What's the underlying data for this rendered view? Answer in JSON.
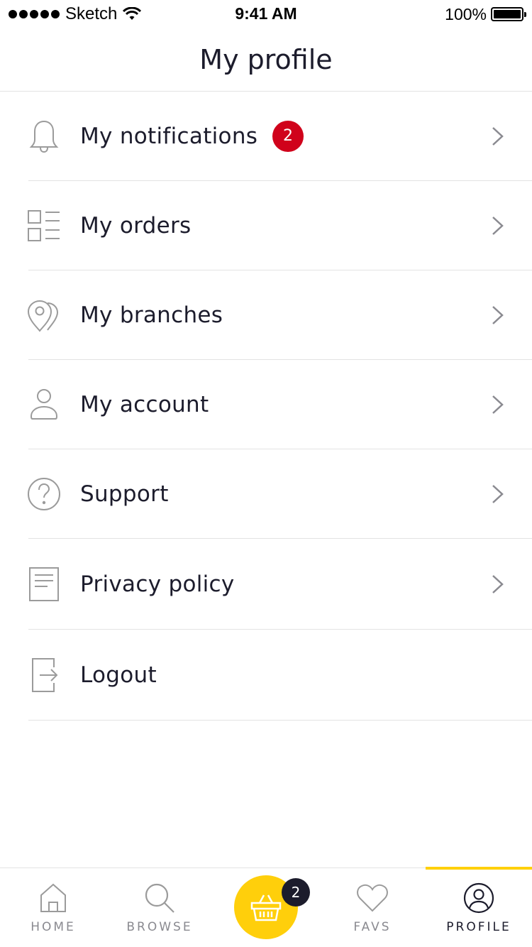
{
  "status_bar": {
    "carrier": "Sketch",
    "time": "9:41 AM",
    "battery": "100%"
  },
  "header": {
    "title": "My profile"
  },
  "menu": {
    "items": [
      {
        "label": "My notifications",
        "icon": "bell-icon",
        "badge": "2",
        "chevron": true
      },
      {
        "label": "My orders",
        "icon": "list-icon",
        "chevron": true
      },
      {
        "label": "My branches",
        "icon": "location-pins-icon",
        "chevron": true
      },
      {
        "label": "My account",
        "icon": "user-icon",
        "chevron": true
      },
      {
        "label": "Support",
        "icon": "question-icon",
        "chevron": true
      },
      {
        "label": "Privacy policy",
        "icon": "document-icon",
        "chevron": true
      },
      {
        "label": "Logout",
        "icon": "logout-icon",
        "chevron": false
      }
    ]
  },
  "tab_bar": {
    "home": "HOME",
    "browse": "BROWSE",
    "basket_badge": "2",
    "favs": "FAVS",
    "profile": "PROFILE",
    "active": "profile"
  },
  "colors": {
    "accent": "#ffcf0b",
    "badge_red": "#d0021b",
    "text": "#1c1c2c",
    "icon_gray": "#9b9b9b"
  }
}
